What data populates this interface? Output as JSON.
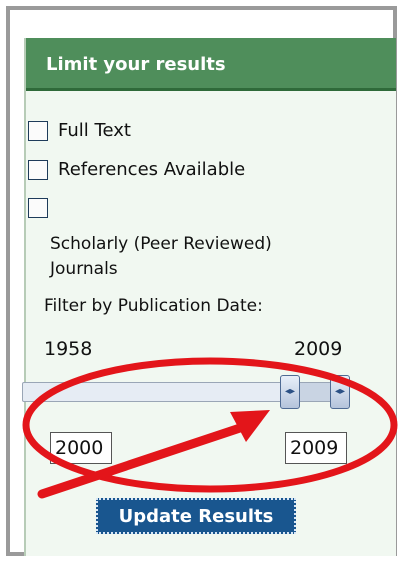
{
  "panel": {
    "title": "Limit your results",
    "options": [
      {
        "label": "Full Text",
        "checked": false
      },
      {
        "label": "References Available",
        "checked": false
      },
      {
        "label": "",
        "checked": false
      }
    ],
    "scholarly_line1": "Scholarly (Peer Reviewed)",
    "scholarly_line2": "Journals",
    "filter_label": "Filter by Publication Date:",
    "date_min": "1958",
    "date_max": "2009",
    "from_year": "2000",
    "to_year": "2009",
    "update_label": "Update Results"
  },
  "colors": {
    "header_green": "#4f8e5b",
    "panel_bg": "#f1f8f1",
    "button_blue": "#19568f",
    "annotation_red": "#e3151a"
  }
}
